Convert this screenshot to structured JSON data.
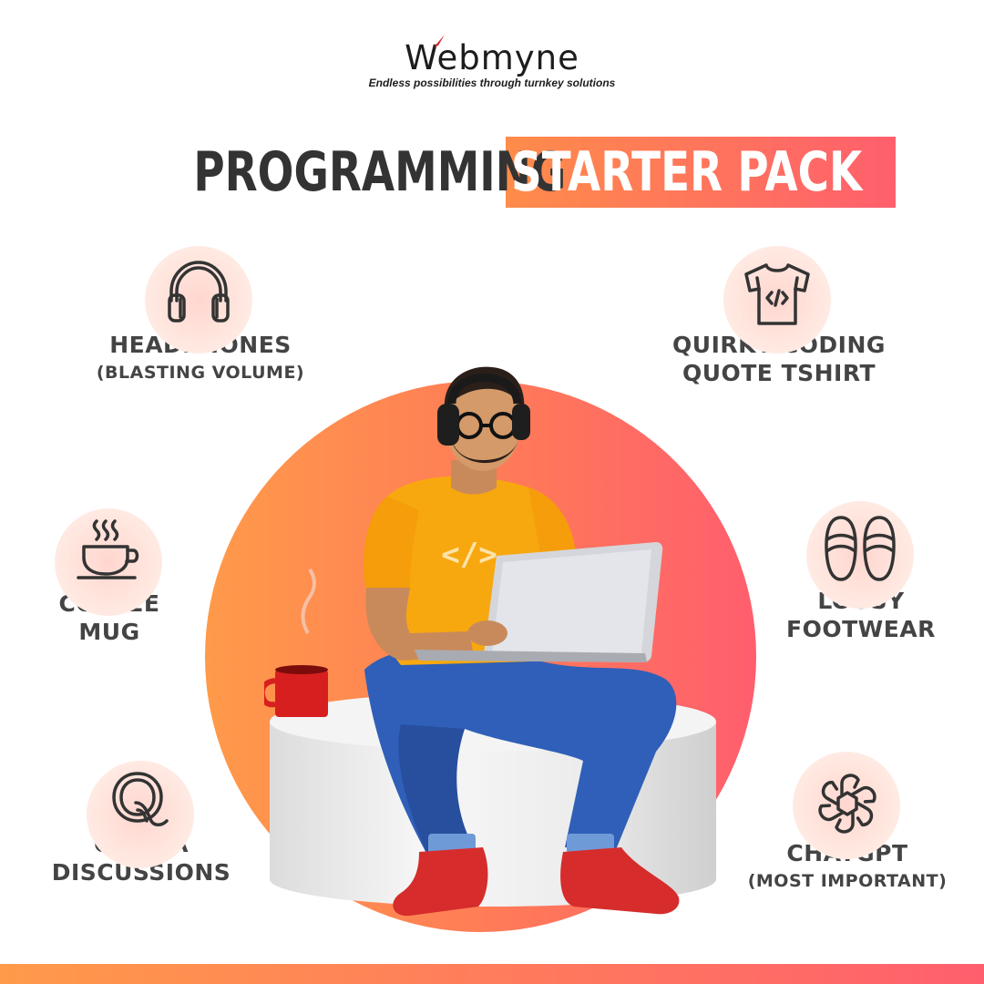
{
  "brand": {
    "name": "Webmyne",
    "tagline": "Endless possibilities through turnkey solutions",
    "accent_color": "#e0202a"
  },
  "title": {
    "part1": "PROGRAMMING",
    "part2": "STARTER PACK"
  },
  "colors": {
    "gradient_start": "#ff9a4a",
    "gradient_end": "#ff5f6d",
    "text_dark": "#444444"
  },
  "features": [
    {
      "id": "headphones",
      "icon": "headphones-icon",
      "label_line1": "HEADPHONES",
      "label_line2": "(BLASTING VOLUME)"
    },
    {
      "id": "tshirt",
      "icon": "code-tshirt-icon",
      "label_line1": "QUIRKY CODING",
      "label_line2": "QUOTE TSHIRT"
    },
    {
      "id": "coffee",
      "icon": "coffee-cup-icon",
      "label_line1": "COFFEE",
      "label_line2": "MUG"
    },
    {
      "id": "footwear",
      "icon": "slippers-icon",
      "label_line1": "LOUSY",
      "label_line2": "FOOTWEAR"
    },
    {
      "id": "quora",
      "icon": "quora-icon",
      "label_line1": "QUORA",
      "label_line2": "DISCUSSIONS"
    },
    {
      "id": "chatgpt",
      "icon": "chatgpt-icon",
      "label_line1": "CHATGPT",
      "label_line2": "(MOST IMPORTANT)"
    }
  ],
  "hero_image": "programmer-with-laptop-illustration"
}
